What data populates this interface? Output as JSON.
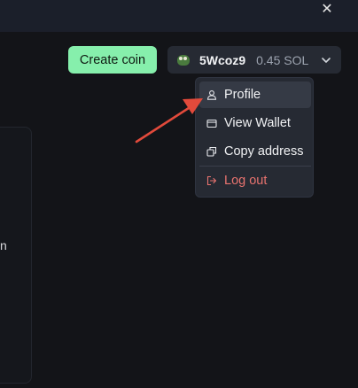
{
  "header": {
    "close_glyph": "✕"
  },
  "toolbar": {
    "create_coin_label": "Create coin",
    "wallet": {
      "name": "5Wcoz9",
      "balance": "0.45 SOL"
    }
  },
  "menu": {
    "items": [
      {
        "label": "Profile",
        "icon": "user-icon"
      },
      {
        "label": "View Wallet",
        "icon": "wallet-icon"
      },
      {
        "label": "Copy address",
        "icon": "copy-icon"
      },
      {
        "label": "Log out",
        "icon": "logout-icon"
      }
    ]
  },
  "content": {
    "left_fragment": "n"
  },
  "colors": {
    "accent_green": "#86efac",
    "danger": "#e8736f",
    "annotation_arrow": "#e24a3b"
  }
}
